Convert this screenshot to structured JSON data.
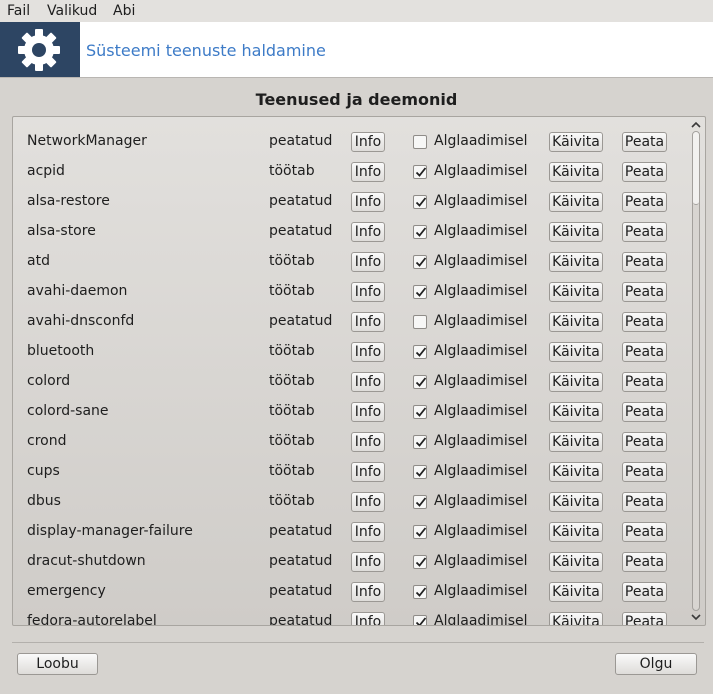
{
  "menu": [
    "Fail",
    "Valikud",
    "Abi"
  ],
  "banner": {
    "title": "Süsteemi teenuste haldamine",
    "icon": "gear-icon",
    "icon_bg": "#2d4563"
  },
  "section_title": "Teenused ja deemonid",
  "row_labels": {
    "info": "Info",
    "autostart": "Alglaadimisel",
    "start": "Käivita",
    "stop": "Peata"
  },
  "services": [
    {
      "name": "NetworkManager",
      "status": "peatatud",
      "autostart": false
    },
    {
      "name": "acpid",
      "status": "töötab",
      "autostart": true
    },
    {
      "name": "alsa-restore",
      "status": "peatatud",
      "autostart": true
    },
    {
      "name": "alsa-store",
      "status": "peatatud",
      "autostart": true
    },
    {
      "name": "atd",
      "status": "töötab",
      "autostart": true
    },
    {
      "name": "avahi-daemon",
      "status": "töötab",
      "autostart": true
    },
    {
      "name": "avahi-dnsconfd",
      "status": "peatatud",
      "autostart": false
    },
    {
      "name": "bluetooth",
      "status": "töötab",
      "autostart": true
    },
    {
      "name": "colord",
      "status": "töötab",
      "autostart": true
    },
    {
      "name": "colord-sane",
      "status": "töötab",
      "autostart": true
    },
    {
      "name": "crond",
      "status": "töötab",
      "autostart": true
    },
    {
      "name": "cups",
      "status": "töötab",
      "autostart": true
    },
    {
      "name": "dbus",
      "status": "töötab",
      "autostart": true
    },
    {
      "name": "display-manager-failure",
      "status": "peatatud",
      "autostart": true
    },
    {
      "name": "dracut-shutdown",
      "status": "peatatud",
      "autostart": true
    },
    {
      "name": "emergency",
      "status": "peatatud",
      "autostart": true
    },
    {
      "name": "fedora-autorelabel",
      "status": "peatatud",
      "autostart": true
    }
  ],
  "footer": {
    "cancel": "Loobu",
    "ok": "Olgu"
  },
  "colors": {
    "accent": "#3d7bc7",
    "background": "#d6d3cf"
  }
}
